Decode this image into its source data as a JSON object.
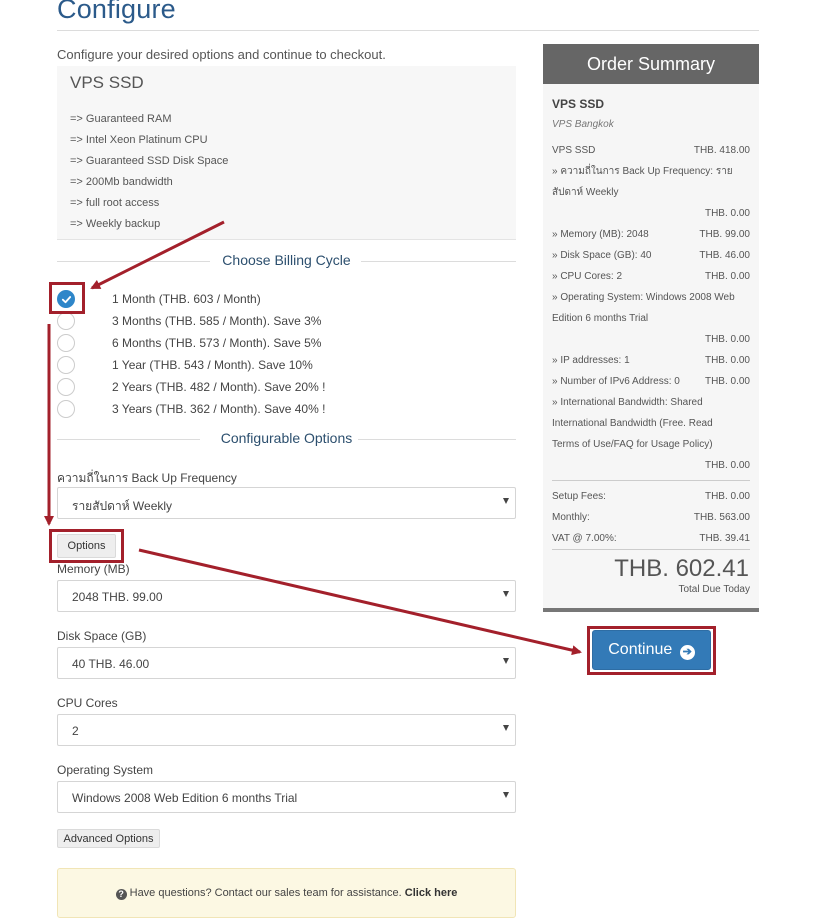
{
  "page": {
    "title": "Configure",
    "subtitle": "Configure your desired options and continue to checkout."
  },
  "product": {
    "name": "VPS SSD",
    "features": [
      "=> Guaranteed RAM",
      "=> Intel Xeon Platinum CPU",
      "=> Guaranteed SSD Disk Space",
      "=> 200Mb bandwidth",
      "=> full root access",
      "=> Weekly backup"
    ]
  },
  "billing": {
    "heading": "Choose Billing Cycle",
    "options": [
      {
        "label": "1 Month (THB. 603 / Month)",
        "checked": true
      },
      {
        "label": "3 Months (THB. 585 / Month). Save 3%",
        "checked": false
      },
      {
        "label": "6 Months (THB. 573 / Month). Save 5%",
        "checked": false
      },
      {
        "label": "1 Year (THB. 543 / Month). Save 10%",
        "checked": false
      },
      {
        "label": "2 Years (THB. 482 / Month). Save 20% !",
        "checked": false
      },
      {
        "label": "3 Years (THB. 362 / Month). Save 40% !",
        "checked": false
      }
    ]
  },
  "configurable": {
    "heading": "Configurable Options",
    "backup_label": "ความถี่ในการ Back Up Frequency",
    "backup_value": "รายสัปดาห์ Weekly",
    "options_button": "Options",
    "memory_label": "Memory (MB)",
    "memory_value": "2048 THB. 99.00",
    "disk_label": "Disk Space (GB)",
    "disk_value": "40 THB. 46.00",
    "cpu_label": "CPU Cores",
    "cpu_value": "2",
    "os_label": "Operating System",
    "os_value": "Windows 2008 Web Edition 6 months Trial",
    "advanced_button": "Advanced Options"
  },
  "help": {
    "text": "Have questions? Contact our sales team for assistance.",
    "link": "Click here"
  },
  "summary": {
    "title": "Order Summary",
    "product": "VPS SSD",
    "group": "VPS Bangkok",
    "base_label": "VPS SSD",
    "base_price": "THB. 418.00",
    "backup_text": "» ความถี่ในการ Back Up Frequency: รายสัปดาห์ Weekly",
    "backup_price": "THB. 0.00",
    "memory_label": "» Memory (MB): 2048",
    "memory_price": "THB. 99.00",
    "disk_label": "» Disk Space (GB): 40",
    "disk_price": "THB. 46.00",
    "cpu_label": "» CPU Cores: 2",
    "cpu_price": "THB. 0.00",
    "os_text": "» Operating System: Windows 2008 Web Edition 6 months Trial",
    "os_price": "THB. 0.00",
    "ip_label": "» IP addresses: 1",
    "ip_price": "THB. 0.00",
    "ipv6_label": "» Number of IPv6 Address: 0",
    "ipv6_price": "THB. 0.00",
    "intl_text": "» International Bandwidth: Shared International Bandwidth (Free. Read Terms of Use/FAQ for Usage Policy)",
    "intl_price": "THB. 0.00",
    "setup_label": "Setup Fees:",
    "setup_price": "THB. 0.00",
    "monthly_label": "Monthly:",
    "monthly_price": "THB. 563.00",
    "vat_label": "VAT @ 7.00%:",
    "vat_price": "THB. 39.41",
    "total": "THB. 602.41",
    "total_label": "Total Due Today"
  },
  "continue_button": "Continue",
  "colors": {
    "accent": "#337ab7",
    "annotation": "#a3202b",
    "title": "#2b5a8a"
  }
}
